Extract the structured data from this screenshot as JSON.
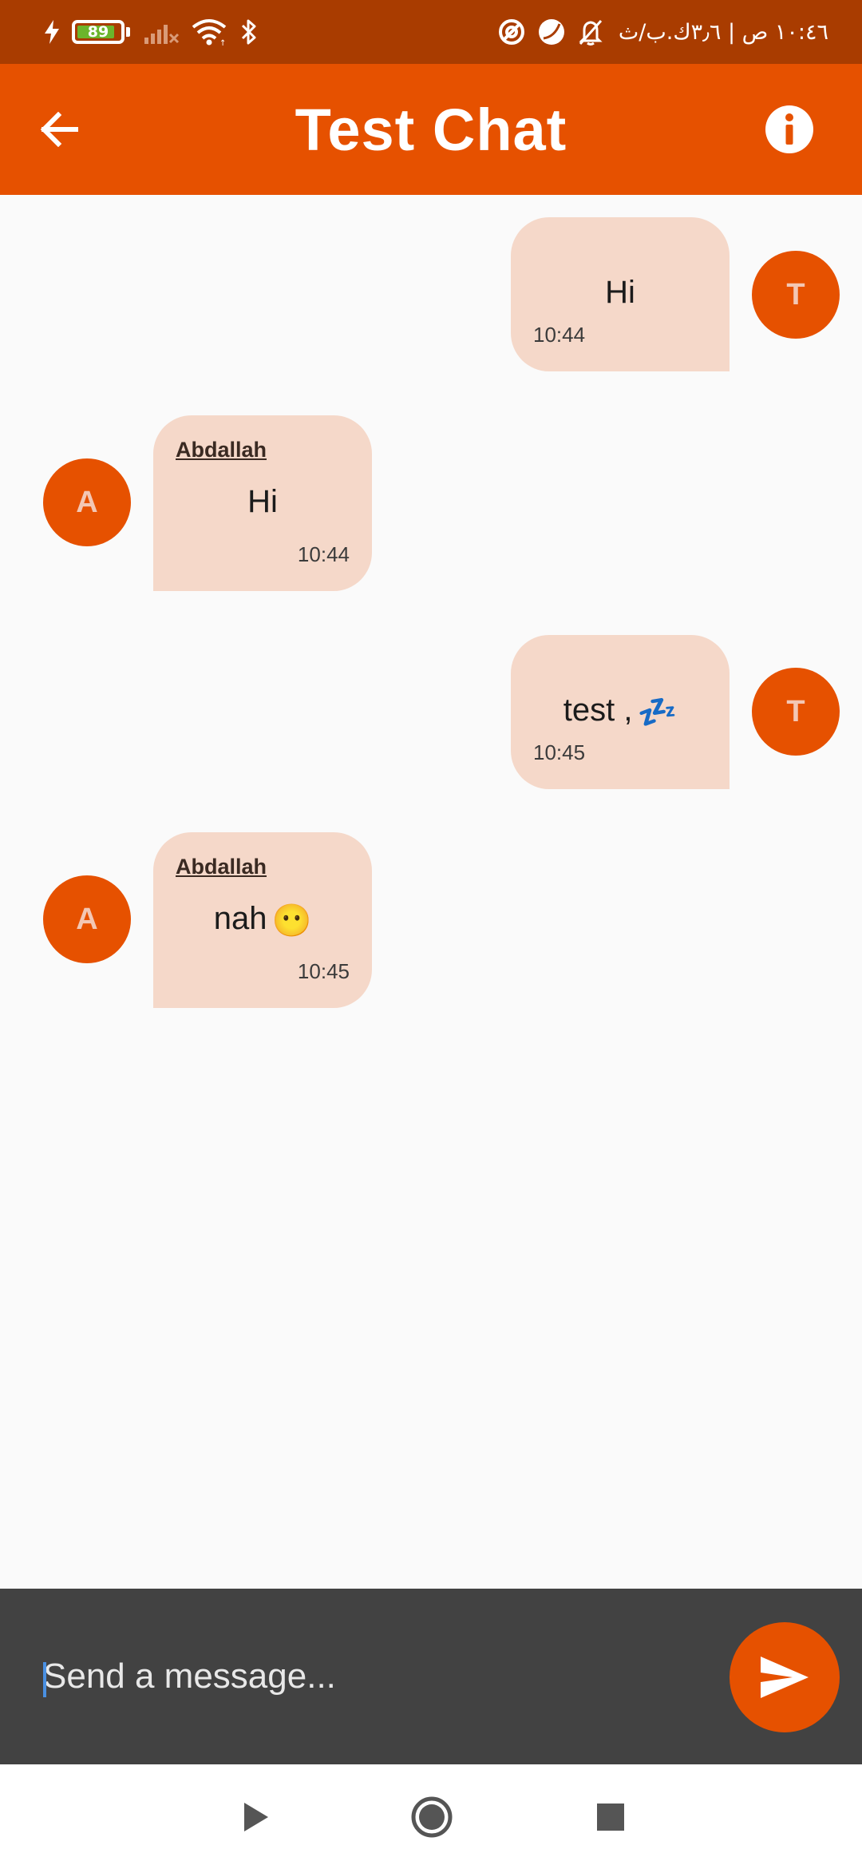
{
  "status_bar": {
    "battery_level": "89",
    "battery_fraction": 0.89,
    "clock_text": "١٠:٤٦ ص | ٣٫٦ك.ب/ث",
    "icons": [
      "charging-icon",
      "battery-icon",
      "signal-off-icon",
      "wifi-icon",
      "bluetooth-icon",
      "data-saver-icon",
      "dnd-moon-icon",
      "notifications-muted-icon"
    ]
  },
  "app_bar": {
    "title": "Test Chat",
    "back_icon": "arrow-left-icon",
    "info_icon": "info-icon"
  },
  "messages": [
    {
      "direction": "sent",
      "avatar_initial": "T",
      "text": "Hi",
      "emoji": "",
      "time": "10:44"
    },
    {
      "direction": "received",
      "sender": "Abdallah",
      "avatar_initial": "A",
      "text": "Hi",
      "emoji": "",
      "time": "10:44"
    },
    {
      "direction": "sent",
      "avatar_initial": "T",
      "text": "test ,",
      "emoji": "💤",
      "time": "10:45"
    },
    {
      "direction": "received",
      "sender": "Abdallah",
      "avatar_initial": "A",
      "text": "nah",
      "emoji": "😶",
      "time": "10:45"
    }
  ],
  "composer": {
    "placeholder": "Send a message...",
    "value": "",
    "send_icon": "send-icon"
  },
  "nav_bar": {
    "icons": [
      "back-triangle-icon",
      "home-circle-icon",
      "recents-square-icon"
    ]
  },
  "colors": {
    "status_bar": "#a93c00",
    "accent": "#e65100",
    "bubble": "#f5d8c9",
    "composer": "#424242",
    "background": "#fafafa"
  }
}
